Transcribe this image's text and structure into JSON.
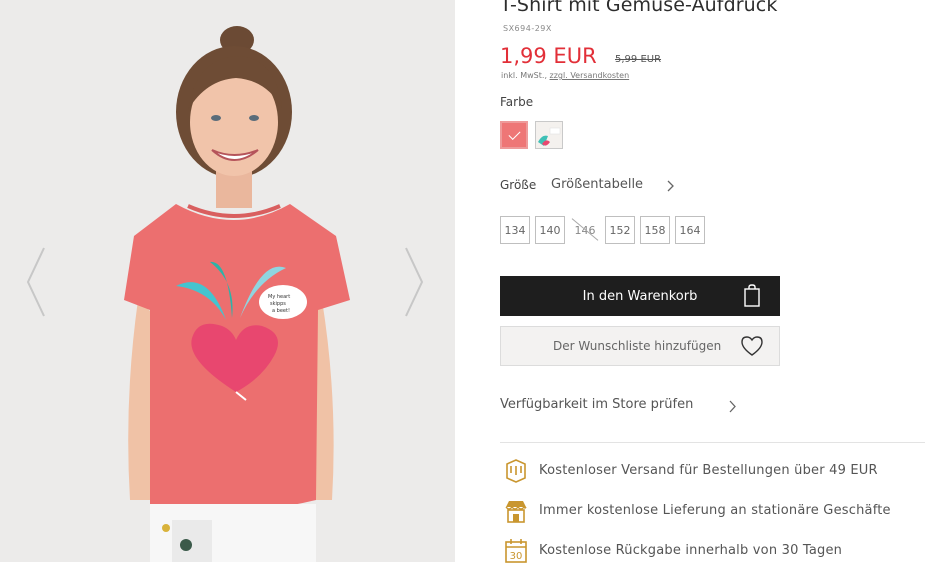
{
  "product": {
    "title": "T-Shirt mit Gemüse-Aufdruck",
    "sku": "SX694-29X",
    "price": "1,99 EUR",
    "old_price": "5,99 EUR",
    "vat_text": "inkl. MwSt.,",
    "shipping_link": "zzgl. Versandkosten"
  },
  "gallery": {
    "shirt_print_text": "My heart skipps a beet!"
  },
  "color": {
    "label": "Farbe",
    "swatches": [
      {
        "name": "coral",
        "color": "#ee7676",
        "selected": true
      },
      {
        "name": "white",
        "color": "#f4f1ee",
        "selected": false
      }
    ]
  },
  "size": {
    "label": "Größe",
    "guide_label": "Größentabelle",
    "options": [
      {
        "label": "134",
        "available": true
      },
      {
        "label": "140",
        "available": true
      },
      {
        "label": "146",
        "available": false
      },
      {
        "label": "152",
        "available": true
      },
      {
        "label": "158",
        "available": true
      },
      {
        "label": "164",
        "available": true
      }
    ]
  },
  "actions": {
    "add_to_cart": "In den Warenkorb",
    "add_to_wishlist": "Der Wunschliste hinzufügen",
    "store_availability": "Verfügbarkeit im Store prüfen"
  },
  "benefits": [
    {
      "icon": "shipping-box-icon",
      "text": "Kostenloser Versand für Bestellungen über 49 EUR"
    },
    {
      "icon": "store-icon",
      "text": "Immer kostenlose Lieferung an stationäre Geschäfte"
    },
    {
      "icon": "calendar-30-icon",
      "text": "Kostenlose Rückgabe innerhalb von 30 Tagen",
      "badge": "30"
    }
  ],
  "colors": {
    "price_red": "#e22f38",
    "accent_gold": "#c9962f",
    "button_dark": "#1e1e1e"
  }
}
